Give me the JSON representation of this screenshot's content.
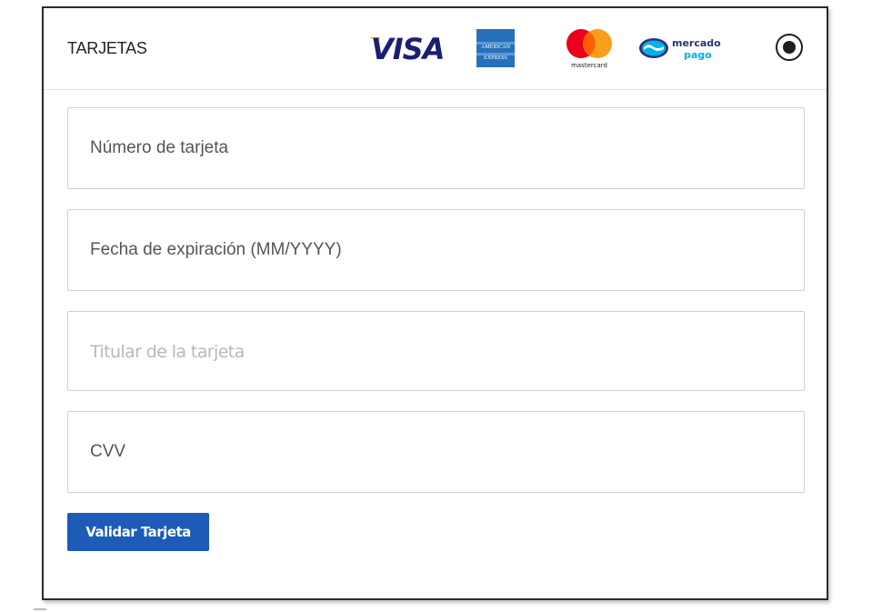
{
  "header": {
    "title": "TARJETAS",
    "logos": {
      "visa": "VISA",
      "amex_top": "AMERICAN",
      "amex_bottom": "EXPRESS",
      "mastercard": "mastercard",
      "mercadopago_top": "mercado",
      "mercadopago_bottom": "pago"
    },
    "radio_selected": true
  },
  "form": {
    "card_number": {
      "value": "Número de tarjeta"
    },
    "expiry": {
      "value": "Fecha de expiración (MM/YYYY)"
    },
    "holder": {
      "placeholder": "Titular de la tarjeta"
    },
    "cvv": {
      "value": "CVV"
    }
  },
  "actions": {
    "validate_label": "Validar Tarjeta"
  },
  "colors": {
    "primary_button": "#1c5bb8",
    "visa_blue": "#1a1f71",
    "visa_gold": "#f7a800",
    "amex_blue": "#2671b9",
    "mc_red": "#eb001b",
    "mc_orange": "#f79e1b",
    "mp_blue": "#2d3277",
    "mp_light": "#00b1ea"
  }
}
